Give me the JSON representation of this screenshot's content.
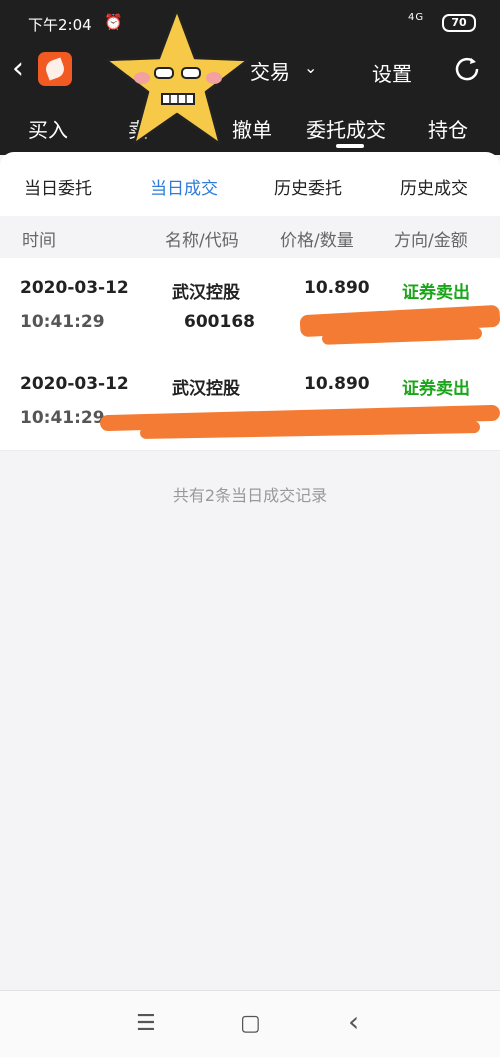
{
  "status_bar": {
    "time": "下午2:04",
    "signal": "4G",
    "battery": "70"
  },
  "header": {
    "title": "交易",
    "settings_label": "设置"
  },
  "nav_tabs": [
    {
      "label": "买入"
    },
    {
      "label": "卖"
    },
    {
      "label": "撤单"
    },
    {
      "label": "委托成交"
    },
    {
      "label": "持仓"
    }
  ],
  "sub_tabs": [
    {
      "label": "当日委托"
    },
    {
      "label": "当日成交"
    },
    {
      "label": "历史委托"
    },
    {
      "label": "历史成交"
    }
  ],
  "columns": {
    "time": "时间",
    "name_code": "名称/代码",
    "price_qty": "价格/数量",
    "dir_amount": "方向/金额"
  },
  "records": [
    {
      "date": "2020-03-12",
      "time": "10:41:29",
      "name": "武汉控股",
      "code": "600168",
      "price": "10.890",
      "direction": "证券卖出"
    },
    {
      "date": "2020-03-12",
      "time": "10:41:29",
      "name": "武汉控股",
      "code": "",
      "price": "10.890",
      "direction": "证券卖出"
    }
  ],
  "footer": {
    "summary": "共有2条当日成交记录"
  },
  "system_nav": {
    "menu": "☰",
    "home": "▢",
    "back": "‹"
  },
  "colors": {
    "active_tab": "#2f7bd6",
    "sell": "#1aa51a",
    "redaction": "#f47b33"
  }
}
